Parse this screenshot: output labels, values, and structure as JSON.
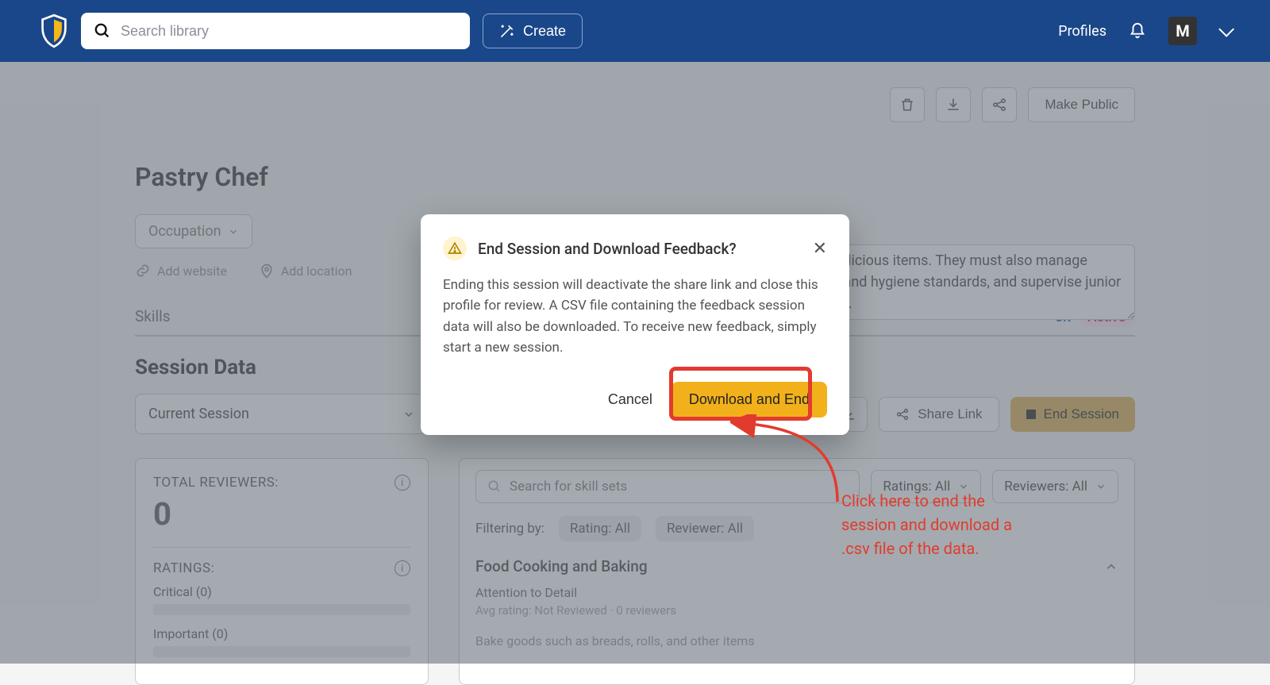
{
  "header": {
    "search_placeholder": "Search library",
    "create": "Create",
    "profiles": "Profiles",
    "avatar_letter": "M"
  },
  "actions": {
    "make_public": "Make Public"
  },
  "page_title": "Pastry Chef",
  "occupation_label": "Occupation",
  "add_website": "Add website",
  "add_location": "Add location",
  "description": "create visually appealing and delicious items. They must also manage inventory, maintain food safety and hygiene standards, and supervise junior bakers or assistant pastry chefs.",
  "tabs": {
    "skills": "Skills",
    "feedback_suffix": "ck",
    "active": "Active"
  },
  "session_heading": "Session Data",
  "session_select": "Current Session",
  "session_buttons": {
    "download": "",
    "share": "Share Link",
    "end": "End Session"
  },
  "stats": {
    "total_label": "TOTAL REVIEWERS:",
    "total_value": "0",
    "ratings_label": "RATINGS:",
    "critical": "Critical (0)",
    "important": "Important (0)"
  },
  "right": {
    "search_placeholder": "Search for skill sets",
    "ratings_filter": "Ratings: All",
    "reviewers_filter": "Reviewers: All",
    "filtering_by": "Filtering by:",
    "chip_rating": "Rating: All",
    "chip_reviewer": "Reviewer: All",
    "section": "Food Cooking and Baking",
    "item1": "Attention to Detail",
    "item1_meta": "Avg rating: Not Reviewed   ·   0 reviewers",
    "item2": "Bake goods such as breads, rolls, and other items"
  },
  "modal": {
    "title": "End Session and Download Feedback?",
    "body": "Ending this session will deactivate the share link and close this profile for review. A CSV file containing the feedback session data will also be downloaded. To receive new feedback, simply start a new session.",
    "cancel": "Cancel",
    "confirm": "Download and End"
  },
  "annotation": "Click here to end the session and download a .csv file of the data."
}
